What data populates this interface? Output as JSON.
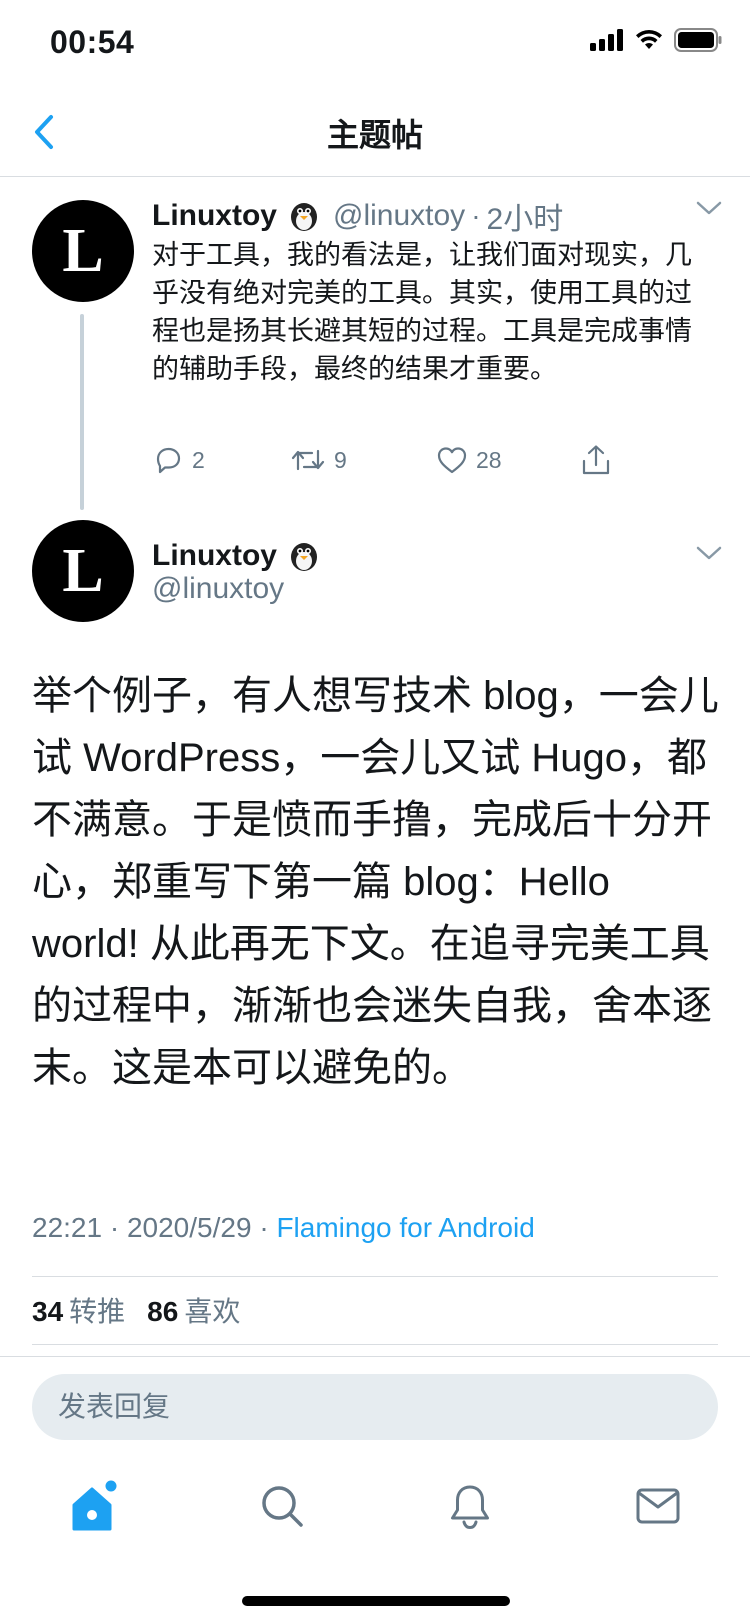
{
  "status_bar": {
    "time": "00:54"
  },
  "nav": {
    "title": "主题帖"
  },
  "reply_context_tweet": {
    "author_name": "Linuxtoy",
    "handle": "@linuxtoy",
    "separator": "·",
    "time_ago": "2小时",
    "text": "对于工具，我的看法是，让我们面对现实，几乎没有绝对完美的工具。其实，使用工具的过程也是扬其长避其短的过程。工具是完成事情的辅助手段，最终的结果才重要。",
    "reply_count": "2",
    "retweet_count": "9",
    "like_count": "28"
  },
  "main_tweet": {
    "author_name": "Linuxtoy",
    "handle": "@linuxtoy",
    "text": "举个例子，有人想写技术 blog，一会儿试 WordPress，一会儿又试 Hugo，都不满意。于是愤而手撸，完成后十分开心，郑重写下第一篇 blog：Hello world! 从此再无下文。在追寻完美工具的过程中，渐渐也会迷失自我，舍本逐末。这是本可以避免的。",
    "time": "22:21",
    "separator": "·",
    "date": "2020/5/29",
    "source": "Flamingo for Android",
    "retweets_count": "34",
    "retweets_label": "转推",
    "likes_count": "86",
    "likes_label": "喜欢"
  },
  "reply_box": {
    "placeholder": "发表回复"
  },
  "avatar_letter": "L",
  "colors": {
    "accent": "#1da1f2",
    "secondary_text": "#657786",
    "divider": "#d9dde1"
  },
  "tabs": [
    "home-icon",
    "search-icon",
    "notifications-icon",
    "messages-icon"
  ]
}
